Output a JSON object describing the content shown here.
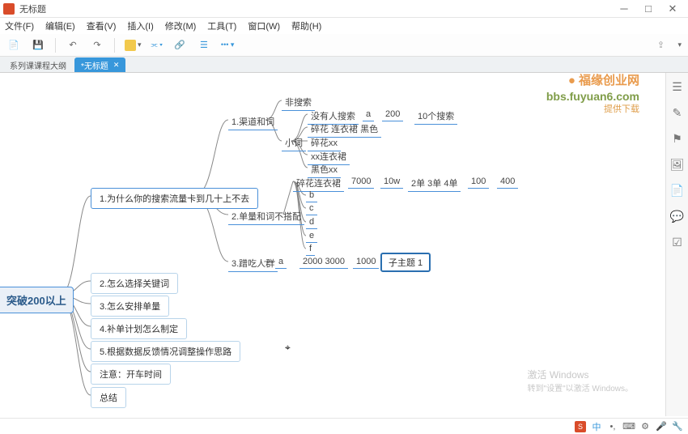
{
  "app": {
    "title": "无标题"
  },
  "menubar": [
    "文件(F)",
    "编辑(E)",
    "查看(V)",
    "插入(I)",
    "修改(M)",
    "工具(T)",
    "窗口(W)",
    "帮助(H)"
  ],
  "tabs": [
    {
      "label": "系列课课程大纲",
      "active": false
    },
    {
      "label": "*无标题",
      "active": true
    }
  ],
  "watermark": {
    "line1": "福缘创业网",
    "line2": "bbs.fuyuan6.com",
    "line3": "提供下载"
  },
  "activate": {
    "l1": "激活 Windows",
    "l2": "转到\"设置\"以激活 Windows。"
  },
  "mindmap": {
    "root": "突破200以上",
    "level1": [
      "1.为什么你的搜索流量卡到几十上不去",
      "2.怎么选择关键词",
      "3.怎么安排单量",
      "4.补单计划怎么制定",
      "5.根据数据反馈情况调整操作思路",
      "注意：开车时间",
      "总结"
    ],
    "b1": {
      "items": [
        "1.渠道和词",
        "2.单量和词不搭配",
        "3.蹭吃人群"
      ],
      "ch1": {
        "labels": [
          "非搜索",
          "小词"
        ],
        "r1": [
          "没有人搜索",
          "a",
          "200",
          "10个搜索"
        ],
        "r2": [
          "碎花 连衣裙 黑色"
        ],
        "r3": [
          "碎花xx",
          "xx连衣裙",
          "黑色xx"
        ]
      },
      "ch2": {
        "head": [
          "碎花连衣裙",
          "7000",
          "10w",
          "2单 3单 4单",
          "100",
          "400"
        ],
        "letters": [
          "b",
          "c",
          "d",
          "e",
          "f"
        ]
      },
      "ch3": {
        "seq": [
          "a",
          "2000 3000",
          "1000",
          "子主题 1"
        ]
      }
    }
  }
}
